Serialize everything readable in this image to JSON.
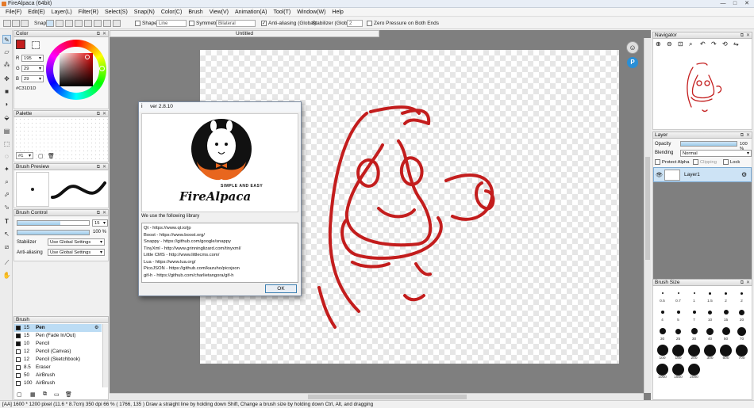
{
  "window": {
    "title": "FireAlpaca (64bit)",
    "buttons": {
      "min": "—",
      "max": "□",
      "close": "✕"
    }
  },
  "menu": [
    "File(F)",
    "Edit(E)",
    "Layer(L)",
    "Filter(R)",
    "Select(S)",
    "Snap(N)",
    "Color(C)",
    "Brush",
    "View(V)",
    "Animation(A)",
    "Tool(T)",
    "Window(W)",
    "Help"
  ],
  "toolbar": {
    "snap": "Snap",
    "shape": "Shape",
    "shape_value": "Line",
    "symmetry": "Symmetry",
    "symmetry_value": "Bilateral",
    "antialias": "Anti-aliasing (Global)",
    "stabilizer": "Stabilizer (Global)",
    "stabilizer_value": "2",
    "zero_pressure": "Zero Pressure on Both Ends"
  },
  "color_panel": {
    "title": "Color",
    "r_label": "R",
    "r": "195",
    "g_label": "G",
    "g": "29",
    "b_label": "B",
    "b": "29",
    "hex": "#C31D1D",
    "current_color": "#c31d1d"
  },
  "palette_panel": {
    "title": "Palette",
    "index": "#1"
  },
  "brush_preview_panel": {
    "title": "Brush Preview"
  },
  "brush_control_panel": {
    "title": "Brush Control",
    "size": "15",
    "opacity": "100 %",
    "size_fraction": 0.6,
    "opacity_fraction": 1.0,
    "stabilizer_label": "Stabilizer",
    "stabilizer_value": "Use Global Settings",
    "antialias_label": "Anti-aliasing",
    "antialias_value": "Use Global Settings"
  },
  "brush_panel": {
    "title": "Brush",
    "items": [
      {
        "size": "15",
        "name": "Pen",
        "selected": true
      },
      {
        "size": "15",
        "name": "Pen (Fade In/Out)"
      },
      {
        "size": "10",
        "name": "Pencil"
      },
      {
        "size": "12",
        "name": "Pencil (Canvas)"
      },
      {
        "size": "12",
        "name": "Pencil (Sketchbook)"
      },
      {
        "size": "8.5",
        "name": "Eraser"
      },
      {
        "size": "50",
        "name": "AirBrush"
      },
      {
        "size": "100",
        "name": "AirBrush"
      }
    ]
  },
  "document": {
    "tab": "Untitled"
  },
  "navigator_panel": {
    "title": "Navigator"
  },
  "layer_panel": {
    "title": "Layer",
    "opacity_label": "Opacity",
    "opacity_value": "100 %",
    "blending_label": "Blending",
    "blending_value": "Normal",
    "protect_alpha": "Protect Alpha",
    "clipping": "Clipping",
    "lock": "Lock",
    "layer_name": "Layer1"
  },
  "brush_size_panel": {
    "title": "Brush Size",
    "sizes": [
      "0.5",
      "0.7",
      "1",
      "1.5",
      "2",
      "2",
      "4",
      "5",
      "7",
      "10",
      "15",
      "20",
      "30",
      "25",
      "30",
      "40",
      "50",
      "70",
      "100",
      "150",
      "200",
      "300",
      "500",
      "700",
      "1000",
      "1500",
      "2000"
    ]
  },
  "about_dialog": {
    "title": "ver 2.8.10",
    "logo_tagline": "SIMPLE AND EASY",
    "logo_name": "FireAlpaca",
    "library_header": "We use the following library",
    "libraries": [
      "Qt - https://www.qt.io/jp",
      "Boost - https://www.boost.org/",
      "Snappy - https://github.com/google/snappy",
      "TinyXml - http://www.grinninglizard.com/tinyxml/",
      "Little CMS - http://www.littlecms.com/",
      "Lua - https://www.lua.org/",
      "PicoJSON - https://github.com/kazuho/picojson",
      "gif-h - https://github.com/charlietangora/gif-h"
    ],
    "ok": "OK"
  },
  "status": {
    "text": "[AA]   1600 * 1200 pixel  (11.6 * 8.7cm)   350 dpi   66 %   ( 1766, 135 )   Draw a straight line by holding down Shift, Change a brush size by holding down Ctrl, Alt, and dragging"
  },
  "colors": {
    "accent": "#3c7fb1",
    "ink": "#c31d1d",
    "logo_orange": "#e8661e"
  }
}
